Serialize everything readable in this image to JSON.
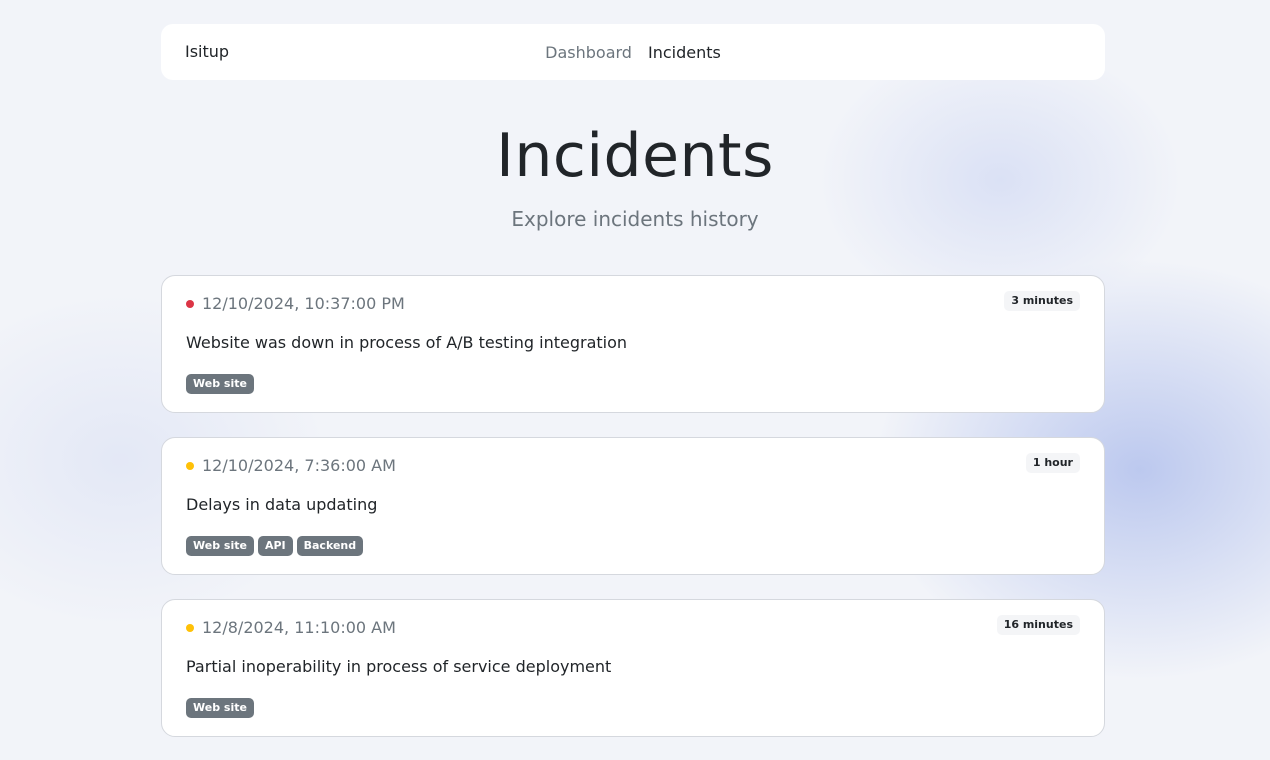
{
  "nav": {
    "brand": "Isitup",
    "links": [
      {
        "label": "Dashboard",
        "active": false
      },
      {
        "label": "Incidents",
        "active": true
      }
    ]
  },
  "header": {
    "title": "Incidents",
    "subtitle": "Explore incidents history"
  },
  "colors": {
    "red_status": "#dc3545",
    "yellow_status": "#ffc107",
    "tag_bg": "#6c757d"
  },
  "incidents": [
    {
      "status": "red",
      "date": "12/10/2024, 10:37:00 PM",
      "duration": "3 minutes",
      "title": "Website was down in process of A/B testing integration",
      "tags": [
        "Web site"
      ]
    },
    {
      "status": "yellow",
      "date": "12/10/2024, 7:36:00 AM",
      "duration": "1 hour",
      "title": "Delays in data updating",
      "tags": [
        "Web site",
        "API",
        "Backend"
      ]
    },
    {
      "status": "yellow",
      "date": "12/8/2024, 11:10:00 AM",
      "duration": "16 minutes",
      "title": "Partial inoperability in process of service deployment",
      "tags": [
        "Web site"
      ]
    }
  ]
}
